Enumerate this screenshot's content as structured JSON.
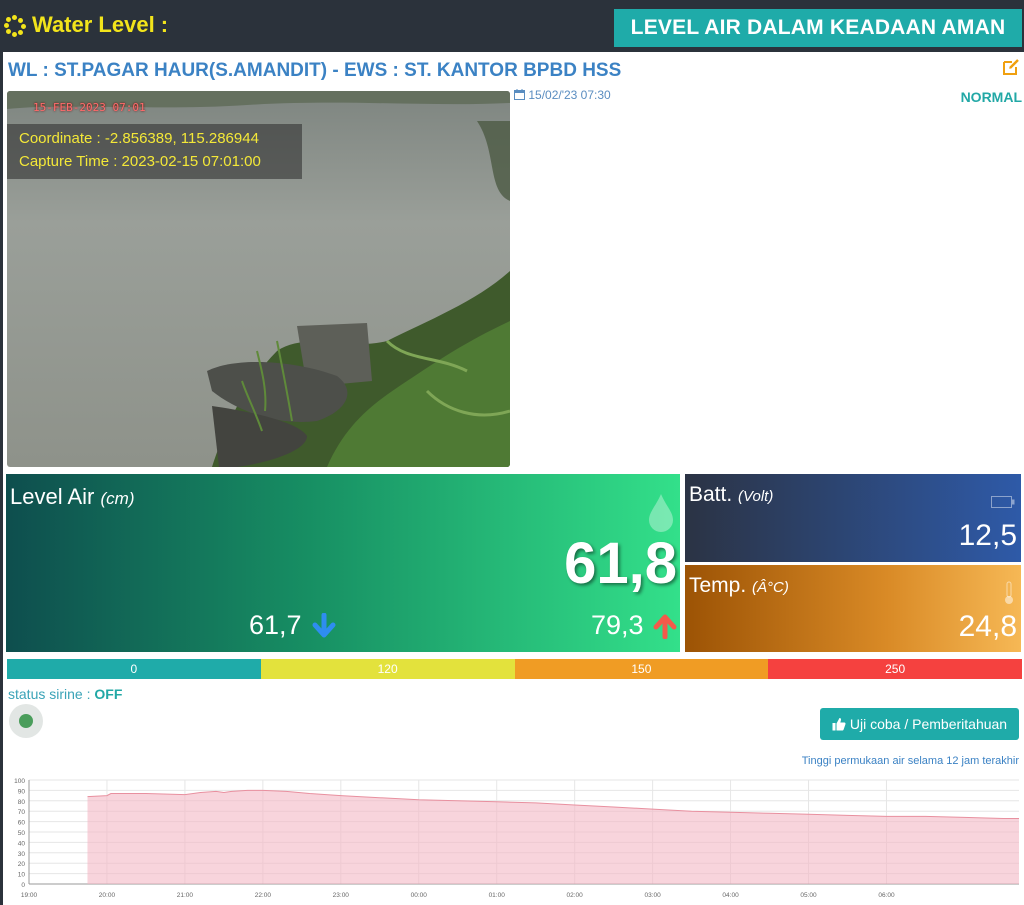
{
  "header": {
    "title": "Water Level :",
    "banner": "LEVEL AIR DALAM KEADAAN AMAN"
  },
  "station": {
    "title": "WL : ST.PAGAR HAUR(S.AMANDIT) - EWS : ST. KANTOR BPBD HSS",
    "status": "NORMAL",
    "capture_date": "15/02/'23 07:30"
  },
  "camera": {
    "stamp": "15-FEB-2023 07:01",
    "coordinate": "Coordinate : -2.856389, 115.286944",
    "capture_time": "Capture Time : 2023-02-15 07:01:00"
  },
  "level": {
    "label": "Level Air",
    "unit": "(cm)",
    "value": "61,8",
    "min": "61,7",
    "max": "79,3"
  },
  "battery": {
    "label": "Batt.",
    "unit": "(Volt)",
    "value": "12,5"
  },
  "temperature": {
    "label": "Temp.",
    "unit": "(Â°C)",
    "value": "24,8"
  },
  "scale": [
    {
      "label": "0",
      "color": "#1faba9"
    },
    {
      "label": "120",
      "color": "#e3e23c"
    },
    {
      "label": "150",
      "color": "#f09c24"
    },
    {
      "label": "250",
      "color": "#f5413f"
    }
  ],
  "siren": {
    "label": "status sirine : ",
    "value": "OFF"
  },
  "test_button": {
    "label": "Uji coba / Pemberitahuan"
  },
  "colors": {
    "accent": "#1faba9",
    "title_yellow": "#f2e41b",
    "link_blue": "#3b82c4"
  },
  "chart_data": {
    "type": "area",
    "title": "Tinggi permukaan air selama 12 jam terakhir",
    "xlabel": "",
    "ylabel": "",
    "ylim": [
      0,
      100
    ],
    "yticks": [
      0,
      10,
      20,
      30,
      40,
      50,
      60,
      70,
      80,
      90,
      100
    ],
    "xticks": [
      "19:00",
      "20:00",
      "21:00",
      "22:00",
      "23:00",
      "00:00",
      "01:00",
      "02:00",
      "03:00",
      "04:00",
      "05:00",
      "06:00"
    ],
    "xrange_hours": [
      19,
      31.7
    ],
    "grid": true,
    "series": [
      {
        "color": "#f4b8c4",
        "x": [
          19.75,
          20.0,
          20.05,
          20.5,
          21.0,
          21.2,
          21.4,
          21.5,
          21.6,
          21.8,
          22.0,
          22.3,
          22.6,
          23.0,
          23.5,
          24.0,
          24.5,
          25.0,
          25.5,
          26.0,
          26.5,
          27.0,
          27.5,
          28.0,
          28.5,
          29.0,
          29.5,
          30.0,
          30.5,
          31.0,
          31.5,
          31.7
        ],
        "y": [
          84,
          85,
          87,
          87,
          86,
          88,
          89,
          88,
          89,
          90,
          90,
          89,
          87,
          85,
          83,
          81,
          80,
          79,
          78,
          76,
          74,
          72,
          70,
          69,
          68,
          67,
          66,
          65,
          65,
          64,
          63,
          63
        ]
      }
    ]
  }
}
